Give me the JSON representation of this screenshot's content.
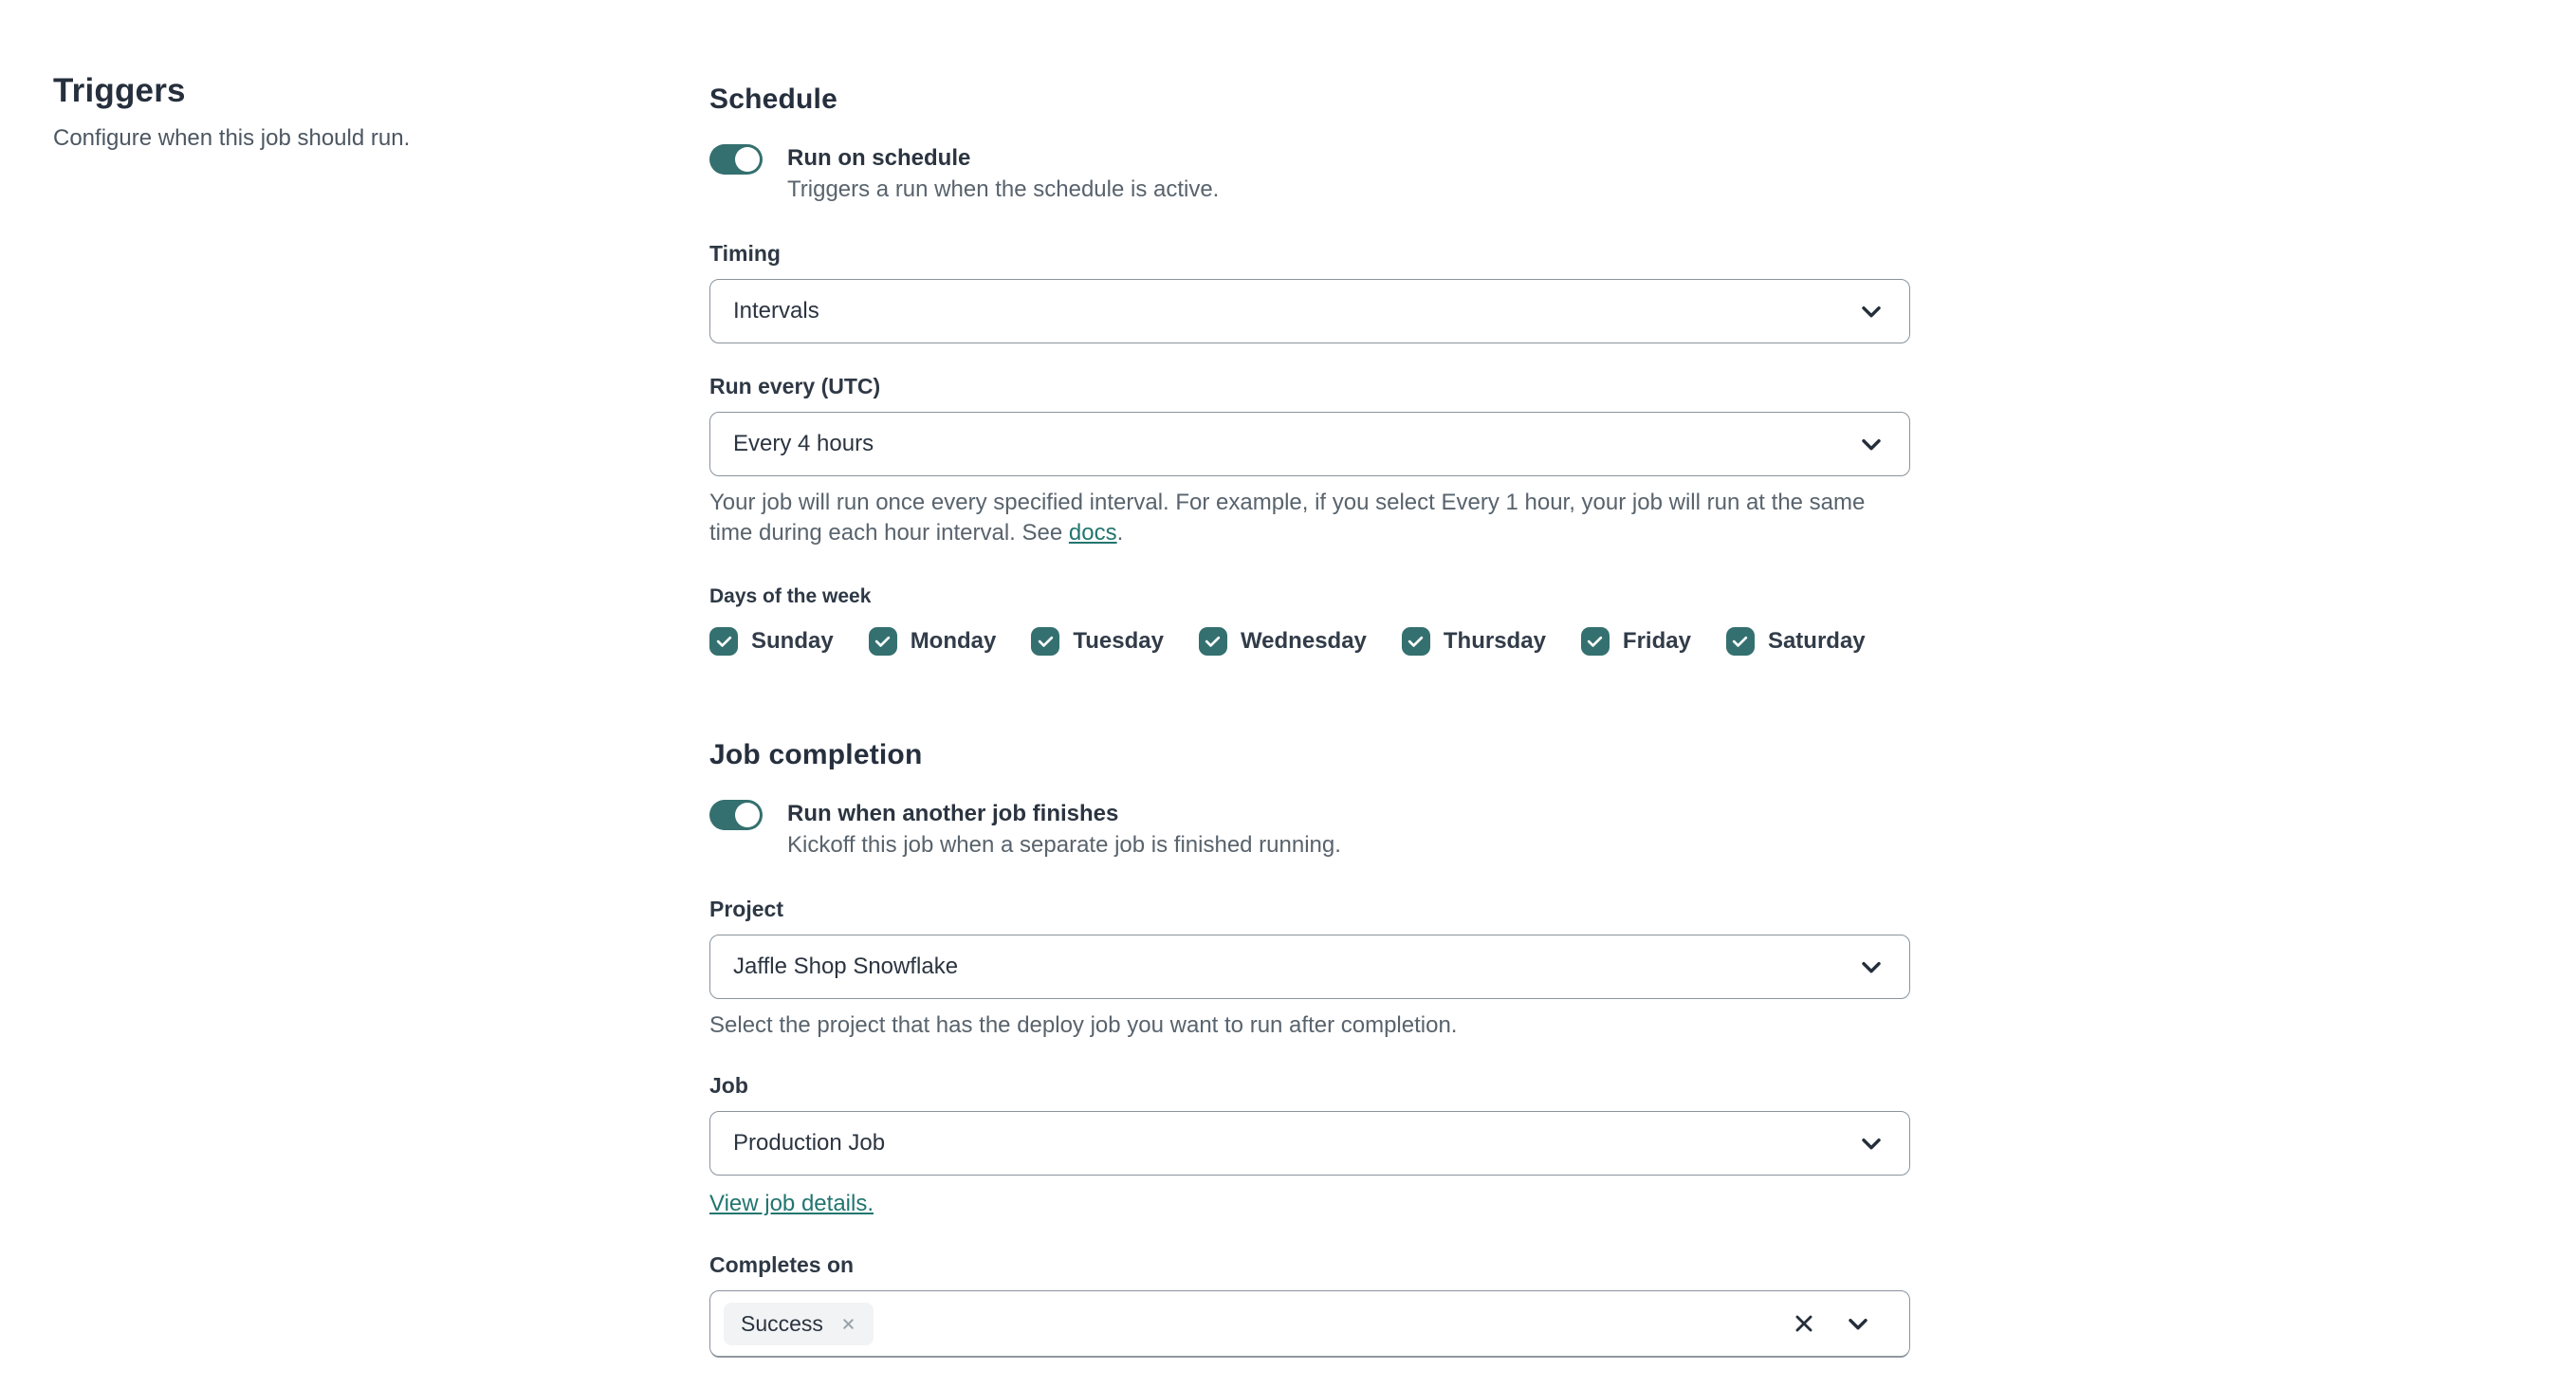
{
  "header": {
    "title": "Triggers",
    "subtitle": "Configure when this job should run."
  },
  "schedule": {
    "heading": "Schedule",
    "run_on_schedule": {
      "label": "Run on schedule",
      "description": "Triggers a run when the schedule is active.",
      "enabled": true
    },
    "timing": {
      "label": "Timing",
      "value": "Intervals"
    },
    "run_every": {
      "label": "Run every (UTC)",
      "value": "Every 4 hours",
      "help_text": "Your job will run once every specified interval. For example, if you select Every 1 hour, your job will run at the same time during each hour interval. See ",
      "help_link_label": "docs",
      "help_suffix": "."
    },
    "days_of_week": {
      "label": "Days of the week",
      "days": [
        {
          "label": "Sunday",
          "checked": true
        },
        {
          "label": "Monday",
          "checked": true
        },
        {
          "label": "Tuesday",
          "checked": true
        },
        {
          "label": "Wednesday",
          "checked": true
        },
        {
          "label": "Thursday",
          "checked": true
        },
        {
          "label": "Friday",
          "checked": true
        },
        {
          "label": "Saturday",
          "checked": true
        }
      ]
    }
  },
  "job_completion": {
    "heading": "Job completion",
    "run_when_finishes": {
      "label": "Run when another job finishes",
      "description": "Kickoff this job when a separate job is finished running.",
      "enabled": true
    },
    "project": {
      "label": "Project",
      "value": "Jaffle Shop Snowflake",
      "help_text": "Select the project that has the deploy job you want to run after completion."
    },
    "job": {
      "label": "Job",
      "value": "Production Job",
      "details_link_label": "View job details."
    },
    "completes_on": {
      "label": "Completes on",
      "selected": [
        "Success"
      ]
    }
  },
  "colors": {
    "accent_teal": "#34706f",
    "link_teal": "#22756f",
    "text_dark": "#2b3440",
    "text_muted": "#58636d",
    "border": "#8a939c"
  }
}
